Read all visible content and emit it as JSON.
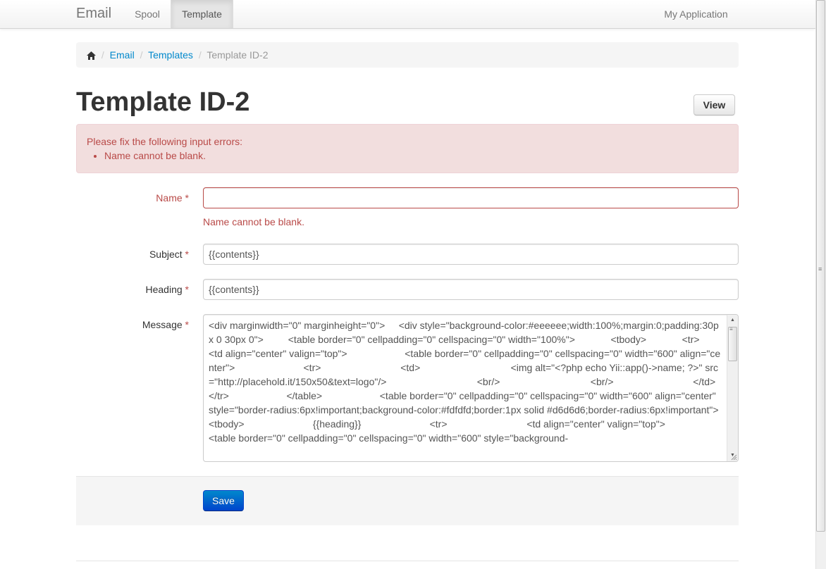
{
  "navbar": {
    "brand": "Email",
    "items": [
      {
        "label": "Spool",
        "active": false
      },
      {
        "label": "Template",
        "active": true
      }
    ],
    "right_link": "My Application"
  },
  "breadcrumb": {
    "home_icon": "home-icon",
    "items": [
      "Email",
      "Templates"
    ],
    "active": "Template ID-2",
    "separator": "/"
  },
  "page": {
    "title": "Template ID-2",
    "view_button": "View"
  },
  "alert": {
    "heading": "Please fix the following input errors:",
    "errors": [
      "Name cannot be blank."
    ]
  },
  "form": {
    "required_marker": "*",
    "name": {
      "label": "Name",
      "value": "",
      "error": "Name cannot be blank."
    },
    "subject": {
      "label": "Subject",
      "value": "{{contents}}"
    },
    "heading": {
      "label": "Heading",
      "value": "{{contents}}"
    },
    "message": {
      "label": "Message",
      "value": "<div marginwidth=\"0\" marginheight=\"0\">     <div style=\"background-color:#eeeeee;width:100%;margin:0;padding:30px 0 30px 0\">         <table border=\"0\" cellpadding=\"0\" cellspacing=\"0\" width=\"100%\">             <tbody>             <tr>                 <td align=\"center\" valign=\"top\">                     <table border=\"0\" cellpadding=\"0\" cellspacing=\"0\" width=\"600\" align=\"center\">                         <tr>                             <td>                                 <img alt=\"<?php echo Yii::app()->name; ?>\" src=\"http://placehold.it/150x50&text=logo\"/>                                 <br/>                                 <br/>                             </td>                         </tr>                     </table>                     <table border=\"0\" cellpadding=\"0\" cellspacing=\"0\" width=\"600\" align=\"center\" style=\"border-radius:6px!important;background-color:#fdfdfd;border:1px solid #d6d6d6;border-radius:6px!important\">                         <tbody>                         {{heading}}                         <tr>                             <td align=\"center\" valign=\"top\">                                 <table border=\"0\" cellpadding=\"0\" cellspacing=\"0\" width=\"600\" style=\"background-"
    },
    "save_button": "Save"
  },
  "colors": {
    "link": "#0088cc",
    "error": "#b94a48",
    "alert_bg": "#f2dede",
    "primary": "#0044cc"
  }
}
